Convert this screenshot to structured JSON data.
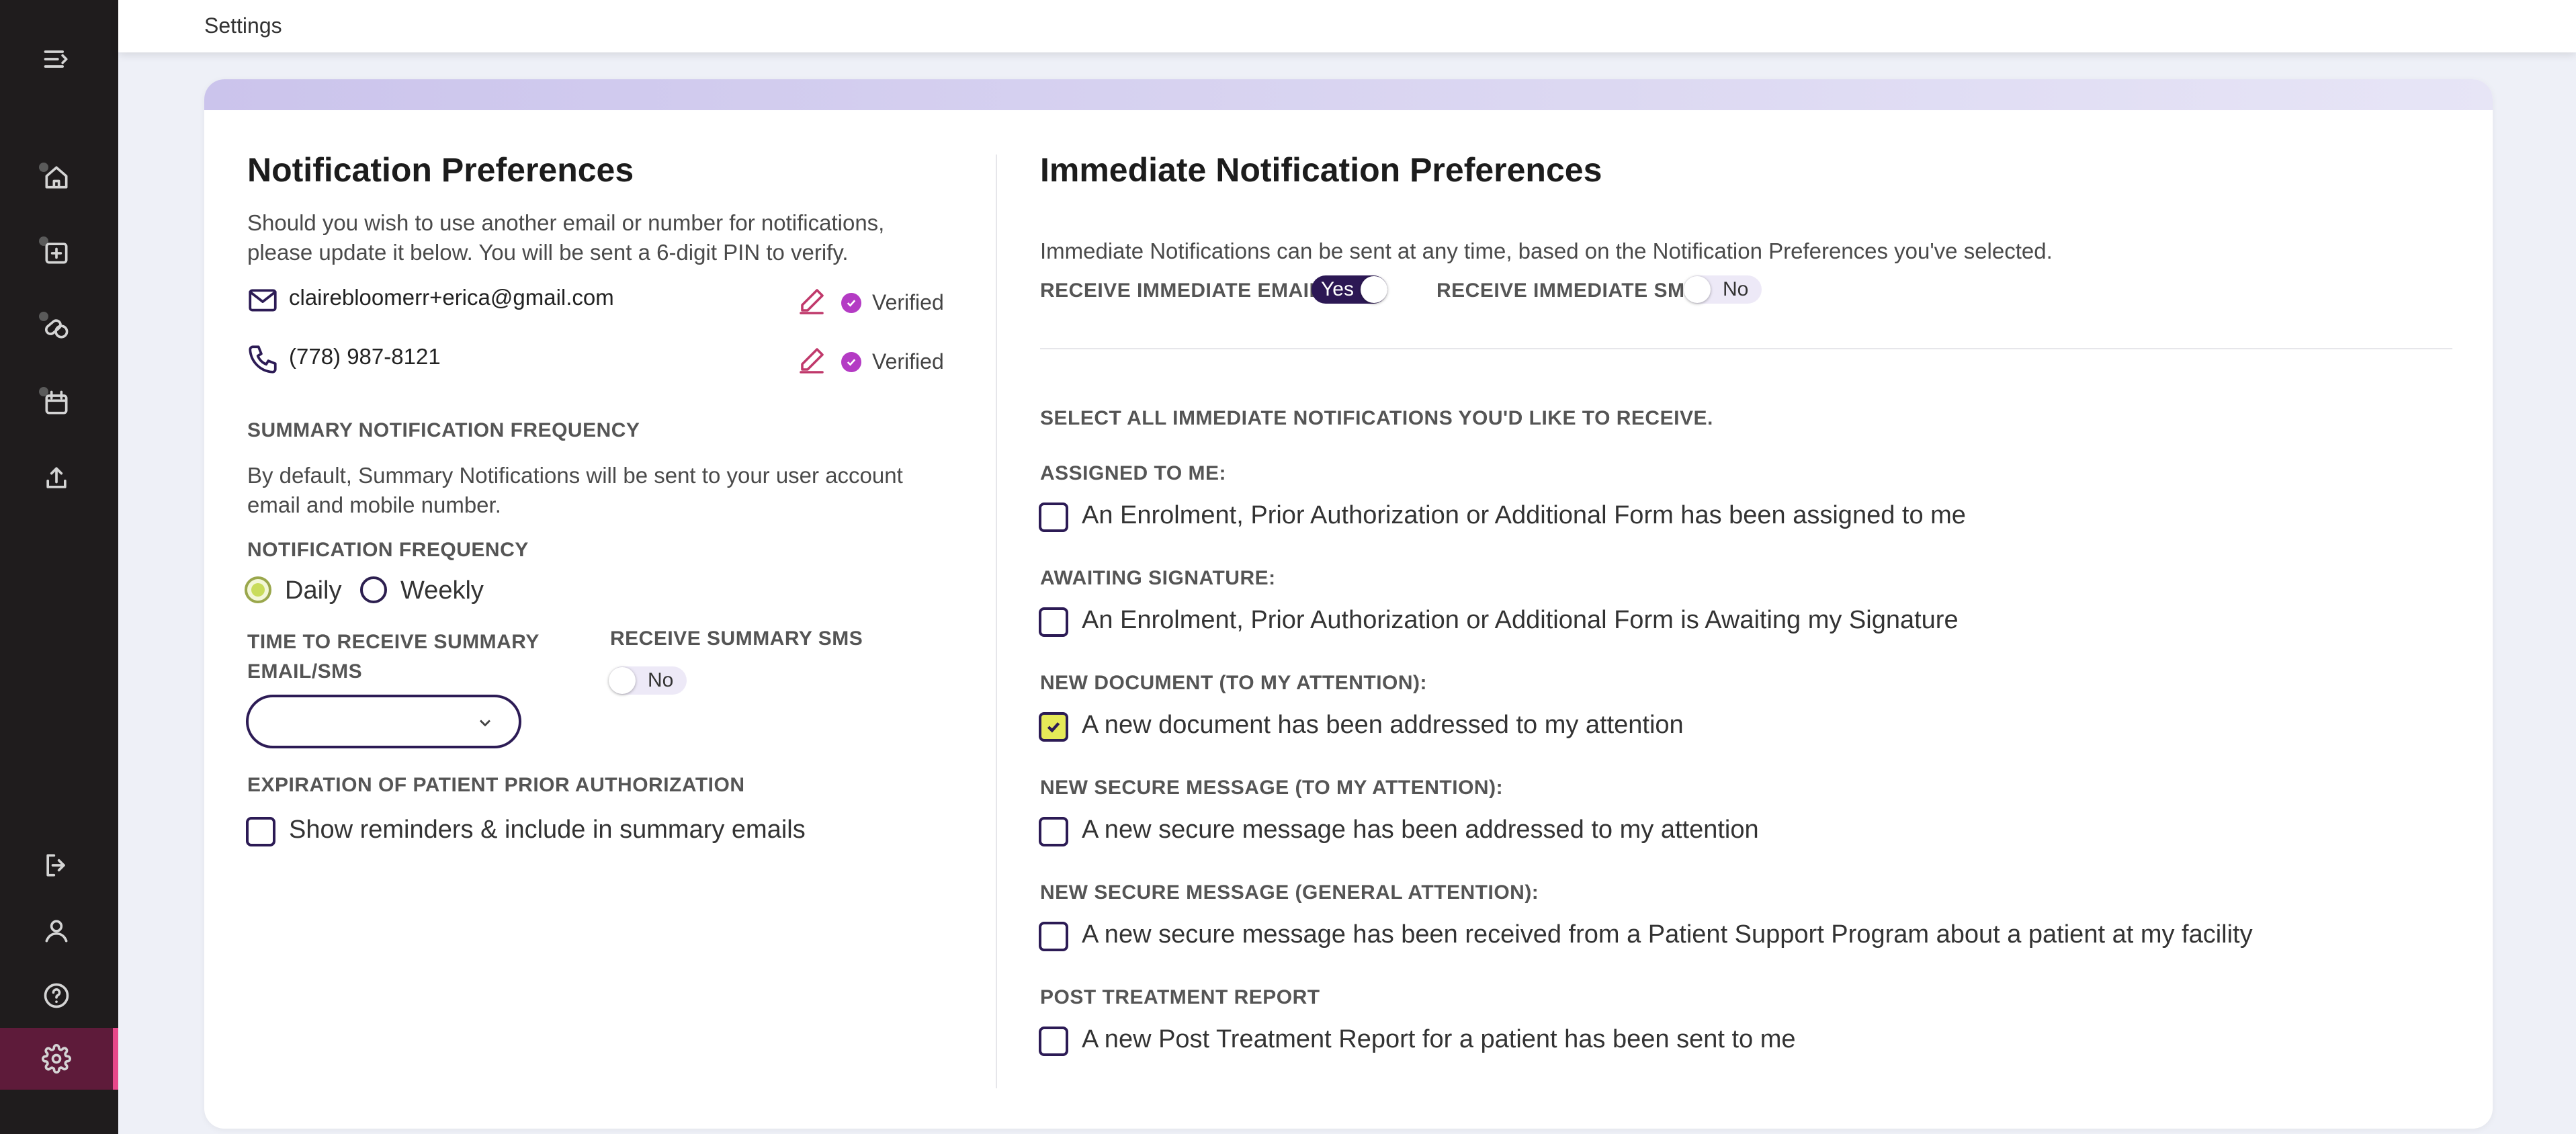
{
  "header": {
    "title": "Settings"
  },
  "sidebar": {
    "items": [
      {
        "icon": "menu-expand-icon"
      },
      {
        "icon": "home-icon"
      },
      {
        "icon": "medical-box-icon"
      },
      {
        "icon": "pills-icon"
      },
      {
        "icon": "calendar-icon"
      },
      {
        "icon": "upload-icon"
      },
      {
        "icon": "logout-icon"
      },
      {
        "icon": "user-icon"
      },
      {
        "icon": "help-icon"
      },
      {
        "icon": "gear-icon",
        "active": true
      }
    ]
  },
  "left": {
    "title": "Notification Preferences",
    "description": "Should you wish to use another email or number for notifications, please update it below. You will be sent a 6-digit PIN to verify.",
    "email": {
      "value": "clairebloomerr+erica@gmail.com",
      "status": "Verified"
    },
    "phone": {
      "value": "(778) 987-8121",
      "status": "Verified"
    },
    "summary_heading": "SUMMARY NOTIFICATION FREQUENCY",
    "summary_description": "By default, Summary Notifications will be sent to your user account email and mobile number.",
    "frequency_label": "NOTIFICATION FREQUENCY",
    "frequency_options": [
      "Daily",
      "Weekly"
    ],
    "frequency_selected": "Daily",
    "time_label": "TIME TO RECEIVE SUMMARY EMAIL/SMS",
    "time_value": "",
    "sms_label": "RECEIVE SUMMARY SMS",
    "sms_toggle": "No",
    "expiration_label": "EXPIRATION OF PATIENT PRIOR AUTHORIZATION",
    "expiration_checkbox": "Show reminders & include in summary emails"
  },
  "right": {
    "title": "Immediate Notification Preferences",
    "description": "Immediate Notifications can be sent at any time, based on the Notification Preferences you've selected.",
    "email_toggle_label": "RECEIVE IMMEDIATE EMAIL",
    "email_toggle": "Yes",
    "sms_toggle_label": "RECEIVE IMMEDIATE SMS",
    "sms_toggle": "No",
    "select_all_label": "SELECT ALL IMMEDIATE NOTIFICATIONS YOU'D LIKE TO RECEIVE.",
    "groups": [
      {
        "label": "ASSIGNED TO ME:",
        "option": "An Enrolment, Prior Authorization or Additional Form has been assigned to me",
        "checked": false
      },
      {
        "label": "AWAITING SIGNATURE:",
        "option": "An Enrolment, Prior Authorization or Additional Form is Awaiting my Signature",
        "checked": false
      },
      {
        "label": "NEW DOCUMENT (TO MY ATTENTION):",
        "option": "A new document has been addressed to my attention",
        "checked": true
      },
      {
        "label": "NEW SECURE MESSAGE (TO MY ATTENTION):",
        "option": "A new secure message has been addressed to my attention",
        "checked": false
      },
      {
        "label": "NEW SECURE MESSAGE (GENERAL ATTENTION):",
        "option": "A new secure message has been received from a Patient Support Program about a patient at my facility",
        "checked": false
      },
      {
        "label": "POST TREATMENT REPORT",
        "option": "A new Post Treatment Report for a patient has been sent to me",
        "checked": false
      }
    ]
  },
  "colors": {
    "accent": "#2c1854",
    "badge": "#b43bc4",
    "edit": "#c0396b",
    "active_nav": "#e8488a",
    "checked": "#e6e958"
  }
}
